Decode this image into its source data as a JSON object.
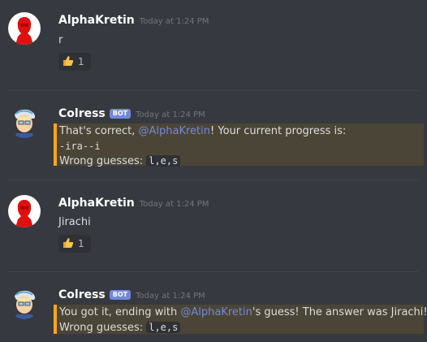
{
  "messages": [
    {
      "username": "AlphaKretin",
      "timestamp": "Today at 1:24 PM",
      "text": "r",
      "reaction": {
        "emoji": "thumbs-up",
        "count": "1"
      }
    },
    {
      "username": "Colress",
      "bot_tag": "BOT",
      "timestamp": "Today at 1:24 PM",
      "embed": {
        "line1_prefix": "That's correct, ",
        "line1_mention": "@AlphaKretin",
        "line1_suffix": "! Your current progress is:",
        "progress": "-ira--i",
        "wrong_label": "Wrong guesses: ",
        "wrong_value": "l,e,s"
      },
      "accent_color": "#faa61a"
    },
    {
      "username": "AlphaKretin",
      "timestamp": "Today at 1:24 PM",
      "text": "Jirachi",
      "reaction": {
        "emoji": "thumbs-up",
        "count": "1"
      }
    },
    {
      "username": "Colress",
      "bot_tag": "BOT",
      "timestamp": "Today at 1:24 PM",
      "embed": {
        "line1_prefix": "You got it, ending with ",
        "line1_mention": "@AlphaKretin",
        "line1_suffix": "'s guess! The answer was Jirachi!",
        "wrong_label": "Wrong guesses: ",
        "wrong_value": "l,e,s"
      },
      "accent_color": "#faa61a"
    }
  ]
}
